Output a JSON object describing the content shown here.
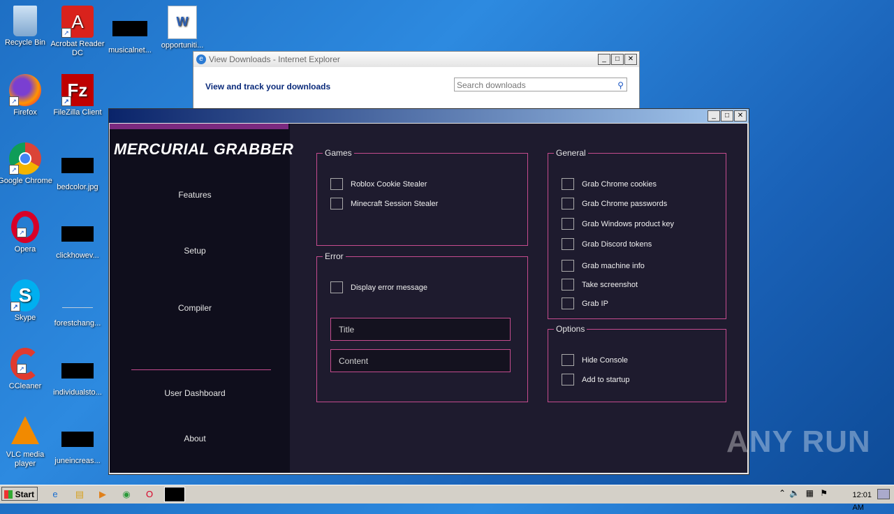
{
  "desktop": {
    "icons": [
      {
        "label": "Recycle Bin",
        "icon": "recycle-bin-icon"
      },
      {
        "label": "Acrobat Reader DC",
        "icon": "acrobat-icon"
      },
      {
        "label": "musicalnet...",
        "icon": "hidden-file-icon"
      },
      {
        "label": "opportuniti...",
        "icon": "word-doc-icon"
      },
      {
        "label": "Firefox",
        "icon": "firefox-icon"
      },
      {
        "label": "FileZilla Client",
        "icon": "filezilla-icon"
      },
      {
        "label": "Google Chrome",
        "icon": "chrome-icon"
      },
      {
        "label": "bedcolor.jpg",
        "icon": "hidden-file-icon"
      },
      {
        "label": "Opera",
        "icon": "opera-icon"
      },
      {
        "label": "clickhowev...",
        "icon": "hidden-file-icon"
      },
      {
        "label": "Skype",
        "icon": "skype-icon"
      },
      {
        "label": "forestchang...",
        "icon": "file-icon"
      },
      {
        "label": "CCleaner",
        "icon": "ccleaner-icon"
      },
      {
        "label": "individualsto...",
        "icon": "hidden-file-icon"
      },
      {
        "label": "VLC media player",
        "icon": "vlc-icon"
      },
      {
        "label": "juneincreas...",
        "icon": "hidden-file-icon"
      }
    ]
  },
  "ie_window": {
    "title": "View Downloads - Internet Explorer",
    "heading": "View and track your downloads",
    "search_placeholder": "Search downloads"
  },
  "app": {
    "logo": "MERCURIAL GRABBER",
    "nav": {
      "features": "Features",
      "setup": "Setup",
      "compiler": "Compiler",
      "dashboard": "User Dashboard",
      "about": "About"
    },
    "games": {
      "legend": "Games",
      "items": [
        "Roblox Cookie Stealer",
        "Minecraft Session Stealer"
      ]
    },
    "error": {
      "legend": "Error",
      "display": "Display error message",
      "title_placeholder": "Title",
      "content_placeholder": "Content"
    },
    "general": {
      "legend": "General",
      "items": [
        "Grab Chrome cookies",
        "Grab Chrome passwords",
        "Grab Windows product key",
        "Grab Discord tokens",
        "Grab machine info",
        "Take screenshot",
        "Grab IP"
      ]
    },
    "options": {
      "legend": "Options",
      "items": [
        "Hide Console",
        "Add to startup"
      ]
    }
  },
  "taskbar": {
    "start": "Start",
    "clock": "12:01 AM"
  },
  "watermark": "ANY RUN"
}
